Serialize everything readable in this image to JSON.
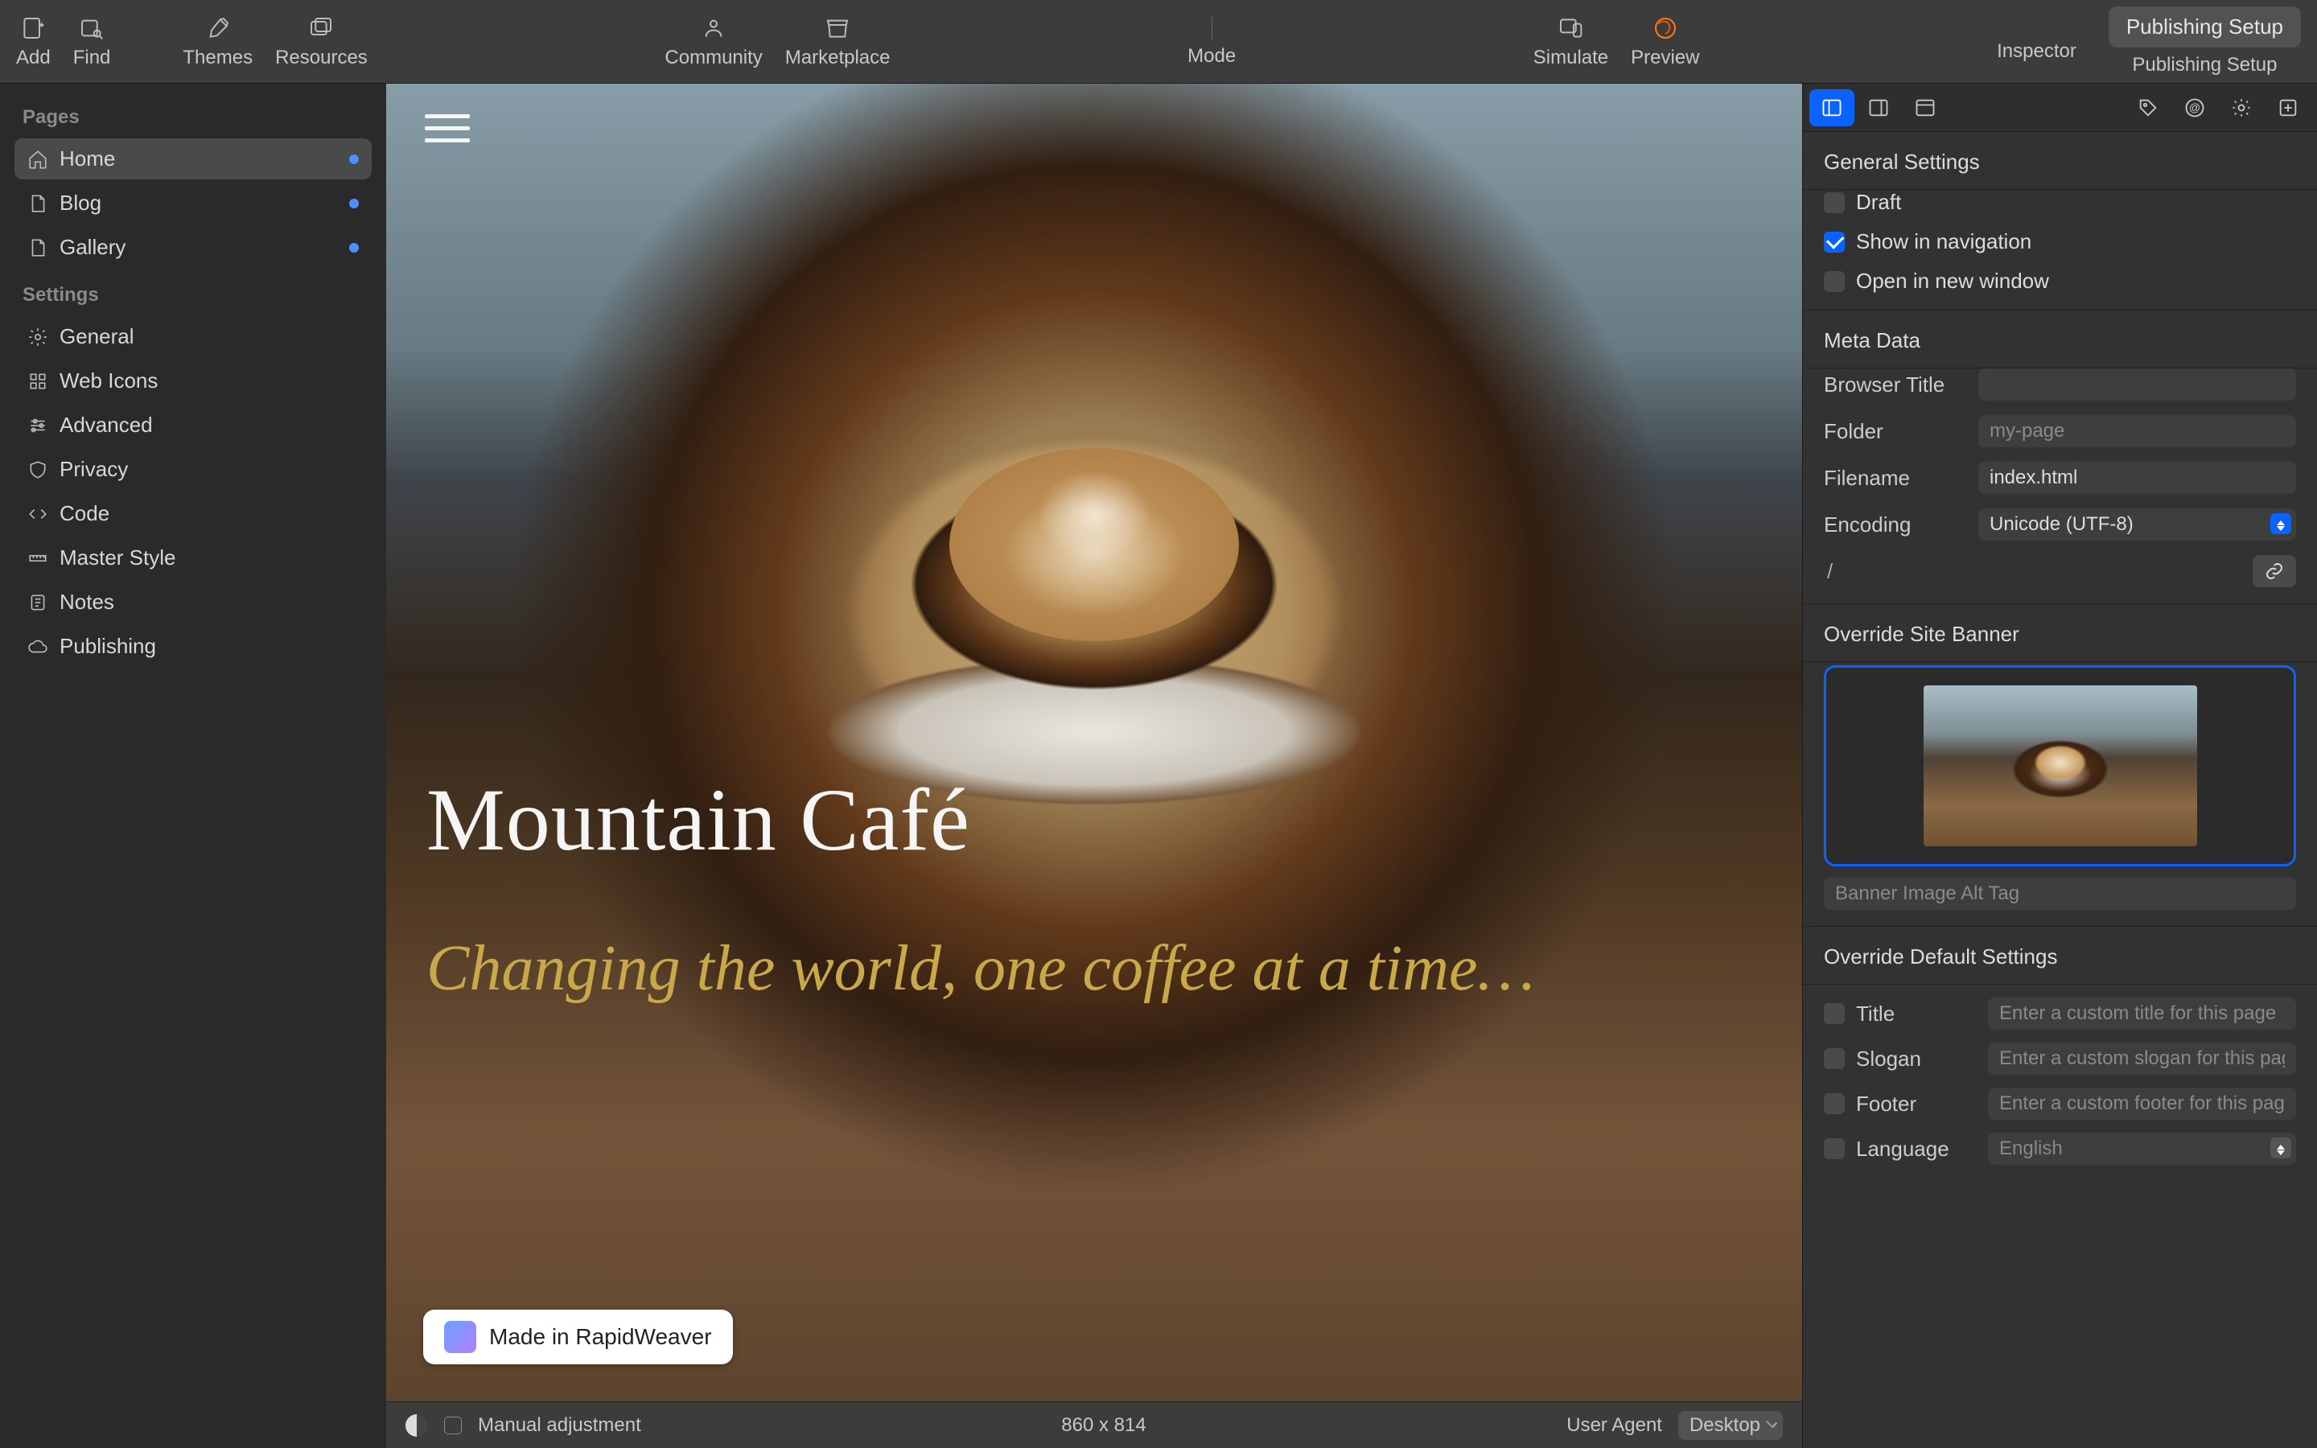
{
  "toolbar": {
    "add": "Add",
    "find": "Find",
    "themes": "Themes",
    "resources": "Resources",
    "community": "Community",
    "marketplace": "Marketplace",
    "mode": "Mode",
    "simulate": "Simulate",
    "preview": "Preview",
    "inspector": "Inspector",
    "publishing_setup_label": "Publishing Setup",
    "publishing_setup_button": "Publishing Setup"
  },
  "sidebar": {
    "pages_header": "Pages",
    "pages": [
      {
        "label": "Home",
        "icon": "home"
      },
      {
        "label": "Blog",
        "icon": "file"
      },
      {
        "label": "Gallery",
        "icon": "file"
      }
    ],
    "settings_header": "Settings",
    "settings": [
      {
        "label": "General",
        "icon": "gear"
      },
      {
        "label": "Web Icons",
        "icon": "grid"
      },
      {
        "label": "Advanced",
        "icon": "sliders"
      },
      {
        "label": "Privacy",
        "icon": "shield"
      },
      {
        "label": "Code",
        "icon": "code"
      },
      {
        "label": "Master Style",
        "icon": "ruler"
      },
      {
        "label": "Notes",
        "icon": "note"
      },
      {
        "label": "Publishing",
        "icon": "cloud"
      }
    ]
  },
  "canvas": {
    "title": "Mountain Café",
    "subtitle": "Changing the world, one coffee at a time…",
    "badge": "Made in RapidWeaver"
  },
  "statusbar": {
    "manual_adjustment": "Manual adjustment",
    "dimensions": "860 x 814",
    "user_agent_label": "User Agent",
    "user_agent_value": "Desktop"
  },
  "inspector": {
    "general_settings": "General Settings",
    "draft": "Draft",
    "show_in_nav": "Show in navigation",
    "open_new_window": "Open in new window",
    "meta_data": "Meta Data",
    "browser_title_label": "Browser Title",
    "browser_title_value": "",
    "folder_label": "Folder",
    "folder_placeholder": "my-page",
    "filename_label": "Filename",
    "filename_value": "index.html",
    "encoding_label": "Encoding",
    "encoding_value": "Unicode (UTF-8)",
    "path": "/",
    "override_banner": "Override Site Banner",
    "banner_alt_placeholder": "Banner Image Alt Tag",
    "override_defaults": "Override Default Settings",
    "title_label": "Title",
    "title_placeholder": "Enter a custom title for this page",
    "slogan_label": "Slogan",
    "slogan_placeholder": "Enter a custom slogan for this page",
    "footer_label": "Footer",
    "footer_placeholder": "Enter a custom footer for this page",
    "language_label": "Language",
    "language_value": "English"
  }
}
